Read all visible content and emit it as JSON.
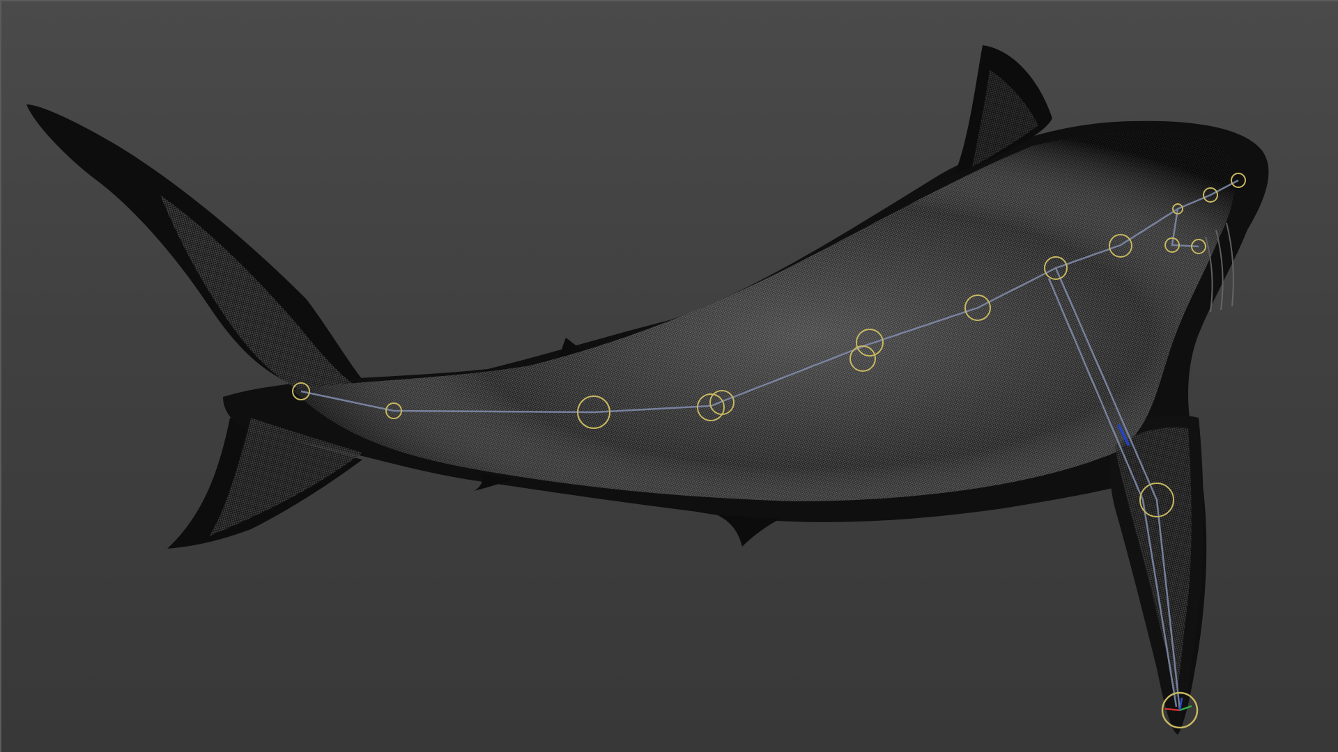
{
  "viewport": {
    "background_top": "#4a4a4a",
    "background_bottom": "#383838",
    "mesh_color": "#101010",
    "wire_color": "#9a9a9a",
    "bone_color": "#7e8aa8",
    "joint_color": "#c8b860"
  },
  "model": {
    "subject": "shark-mesh",
    "display_mode": "wireframe-on-shaded",
    "skeleton_visible": true
  },
  "icons": {
    "gizmo": "transform-gizmo-icon",
    "joint": "joint-icon"
  }
}
